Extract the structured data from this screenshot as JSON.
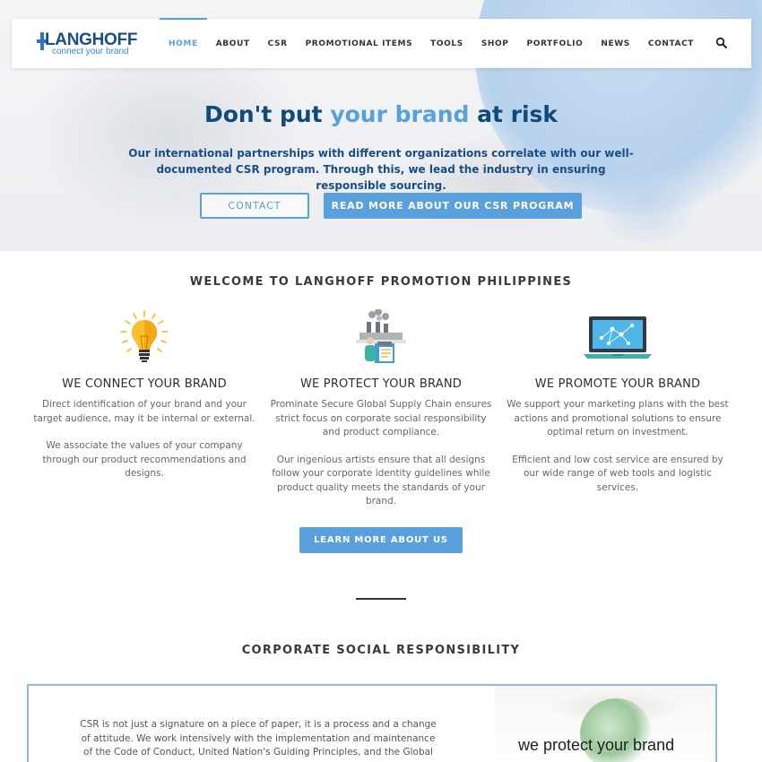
{
  "logo": {
    "name": "LANGHOFF",
    "tagline": "connect your brand"
  },
  "nav": {
    "items": [
      {
        "label": "HOME",
        "active": true
      },
      {
        "label": "ABOUT",
        "active": false
      },
      {
        "label": "CSR",
        "active": false
      },
      {
        "label": "PROMOTIONAL ITEMS",
        "active": false
      },
      {
        "label": "TOOLS",
        "active": false
      },
      {
        "label": "SHOP",
        "active": false
      },
      {
        "label": "PORTFOLIO",
        "active": false
      },
      {
        "label": "NEWS",
        "active": false
      },
      {
        "label": "CONTACT",
        "active": false
      }
    ],
    "search_icon": "search-icon"
  },
  "hero": {
    "title_part1": "Don't put ",
    "title_accent": "your brand",
    "title_part2": " at risk",
    "description": "Our international partnerships with different organizations correlate with our well-documented CSR program. Through this, we lead the industry in ensuring responsible sourcing.",
    "contact_button": "CONTACT",
    "csr_button": "READ MORE ABOUT OUR CSR PROGRAM"
  },
  "welcome": {
    "title": "WELCOME TO LANGHOFF PROMOTION PHILIPPINES",
    "columns": [
      {
        "icon": "lightbulb-icon",
        "title": "WE CONNECT YOUR BRAND",
        "paragraphs": [
          "Direct identification of your brand and your target audience, may it be internal or external.",
          "We associate the values of your company through our product recommendations and designs."
        ]
      },
      {
        "icon": "factory-clipboard-icon",
        "title": "WE PROTECT YOUR BRAND",
        "paragraphs": [
          "Prominate Secure Global Supply Chain ensures strict focus on corporate social responsibility and product compliance.",
          "Our ingenious artists ensure that all designs follow your corporate identity guidelines while product quality meets the standards of your brand."
        ]
      },
      {
        "icon": "laptop-network-icon",
        "title": "WE PROMOTE YOUR BRAND",
        "paragraphs": [
          "We support your marketing plans with the best actions and promotional solutions to ensure optimal return on investment.",
          "Efficient and low cost service are ensured by our wide range of web tools and logistic services."
        ]
      }
    ],
    "learn_button": "LEARN MORE ABOUT US"
  },
  "csr": {
    "title": "CORPORATE SOCIAL RESPONSIBILITY",
    "text": "CSR is not just a signature on a piece of paper, it is a process and a change of attitude. We work intensively with the implementation and maintenance of the Code of Conduct, United Nation's Guiding Principles, and the Global Compact Agreement",
    "image_slogan": "we protect your brand"
  },
  "colors": {
    "accent": "#5aa0dc",
    "navy": "#0f4a7a",
    "border": "#8cbce6"
  }
}
